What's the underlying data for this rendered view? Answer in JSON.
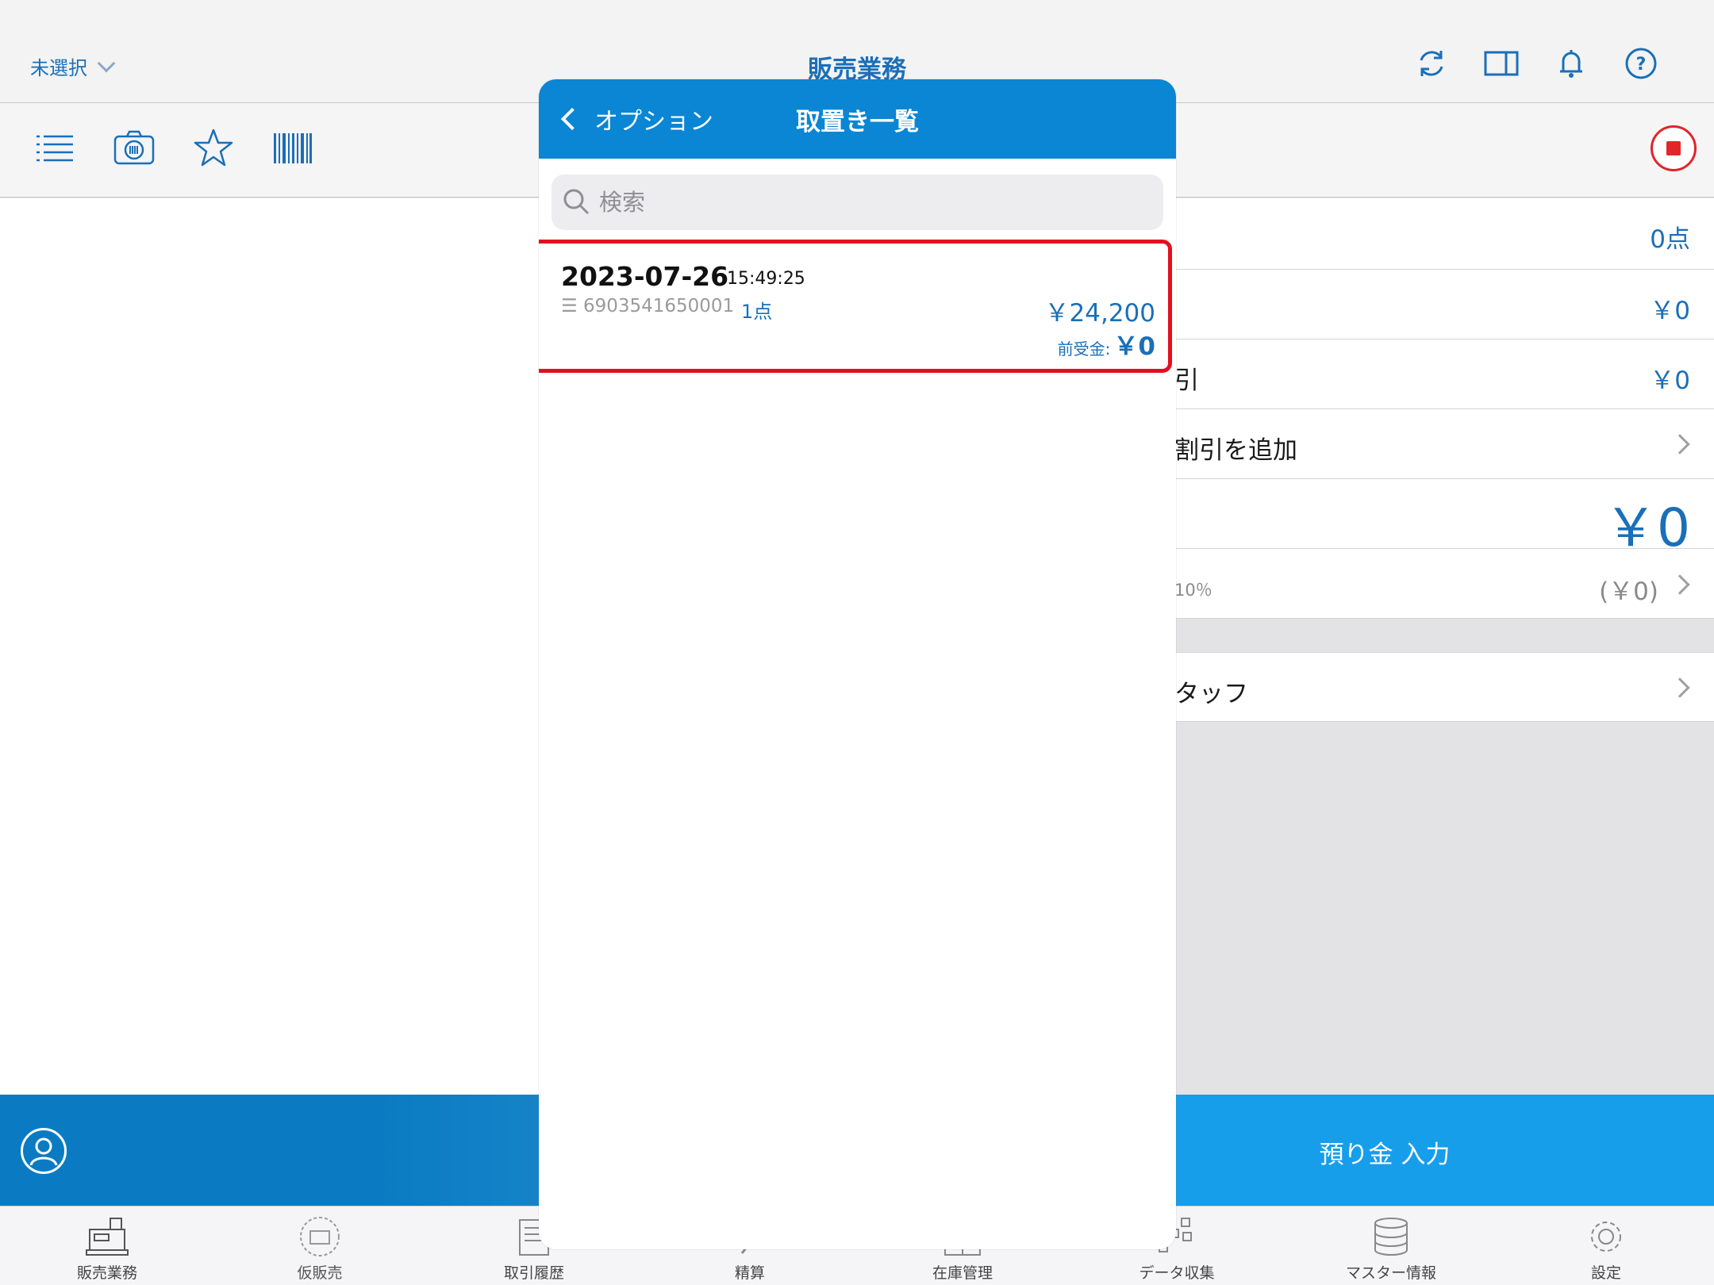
{
  "header": {
    "store_select": "未選択",
    "title": "販売業務"
  },
  "summary": {
    "rows": [
      {
        "label": "",
        "value": "0点"
      },
      {
        "label": "",
        "value": "￥0"
      },
      {
        "label": "引",
        "value": "￥0"
      },
      {
        "label": "割引を追加",
        "value": ""
      },
      {
        "label": "",
        "value": "￥0"
      },
      {
        "label": "10％",
        "value": "(￥0)"
      },
      {
        "label": "タッフ",
        "value": ""
      }
    ]
  },
  "action": {
    "deposit_label": "預り金 入力"
  },
  "tabs": [
    {
      "label": "販売業務"
    },
    {
      "label": "仮販売"
    },
    {
      "label": "取引履歴"
    },
    {
      "label": "精算"
    },
    {
      "label": "在庫管理"
    },
    {
      "label": "データ収集"
    },
    {
      "label": "マスター情報"
    },
    {
      "label": "設定"
    }
  ],
  "modal": {
    "back_label": "オプション",
    "title": "取置き一覧",
    "search_placeholder": "検索",
    "items": [
      {
        "date": "2023-07-26",
        "time": "15:49:25",
        "code": "6903541650001",
        "count": "1点",
        "amount": "￥24,200",
        "advance_label": "前受金:",
        "advance_value": "￥0"
      }
    ]
  },
  "colors": {
    "brand": "#1a6fb8",
    "header_blue": "#0a86d4",
    "action_blue": "#179eeb",
    "highlight_red": "#e3101f"
  }
}
